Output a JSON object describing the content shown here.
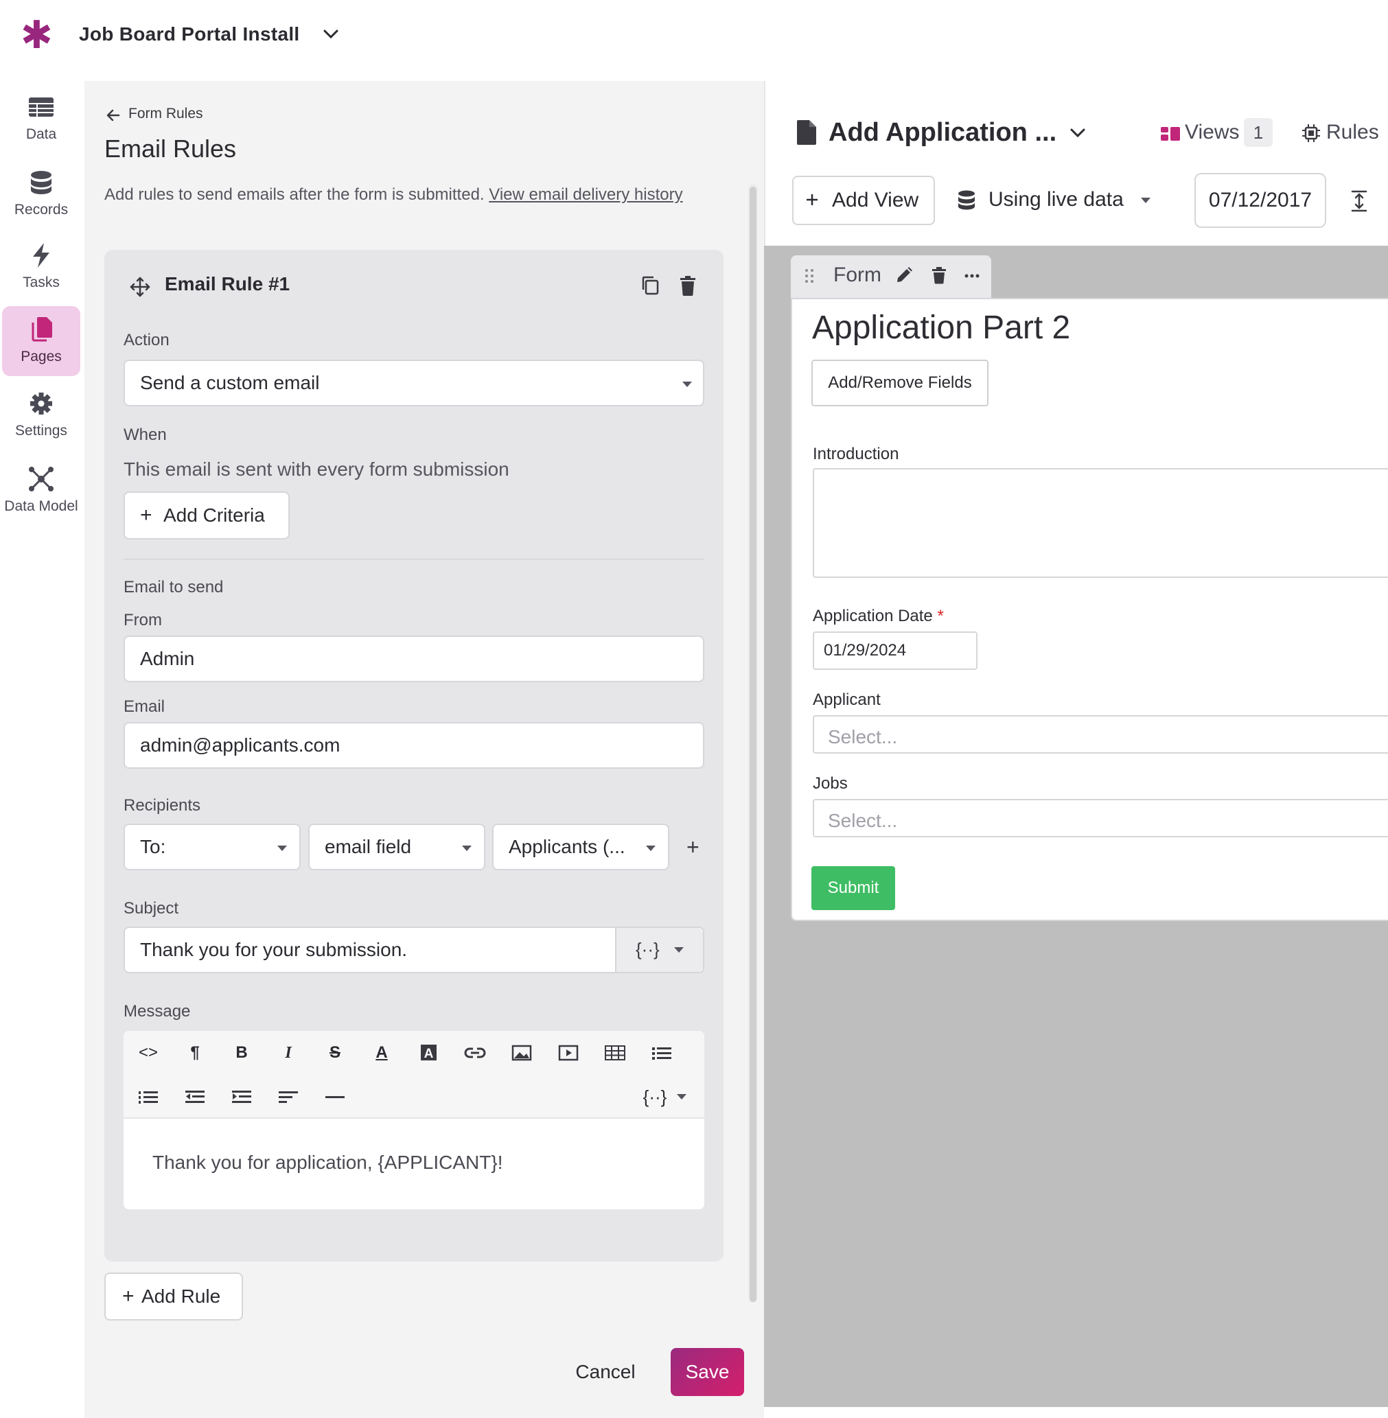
{
  "app": {
    "title": "Job Board Portal Install",
    "brand_color": "#98267d"
  },
  "nav": {
    "items": [
      {
        "label": "Data",
        "icon": "table-icon"
      },
      {
        "label": "Records",
        "icon": "database-icon"
      },
      {
        "label": "Tasks",
        "icon": "lightning-icon"
      },
      {
        "label": "Pages",
        "icon": "pages-icon",
        "active": true
      },
      {
        "label": "Settings",
        "icon": "gear-icon"
      },
      {
        "label": "Data Model",
        "icon": "network-icon"
      }
    ]
  },
  "panel": {
    "back_label": "Form Rules",
    "title": "Email Rules",
    "description": "Add rules to send emails after the form is submitted.",
    "description_link": "View email delivery history",
    "rule": {
      "title": "Email Rule #1",
      "action_label": "Action",
      "action_value": "Send a custom email",
      "when_label": "When",
      "when_text": "This email is sent with every form submission",
      "add_criteria": "Add Criteria",
      "email_to_send_label": "Email to send",
      "from_label": "From",
      "from_value": "Admin",
      "email_label": "Email",
      "email_value": "admin@applicants.com",
      "recipients_label": "Recipients",
      "recipients": [
        "To:",
        "email field",
        "Applicants (..."
      ],
      "subject_label": "Subject",
      "subject_value": "Thank you for your submission.",
      "message_label": "Message",
      "message_value": "Thank you for application, {APPLICANT}!",
      "var_symbol": "{··}"
    },
    "add_rule": "Add Rule",
    "cancel": "Cancel",
    "save": "Save"
  },
  "right": {
    "page_title": "Add Application ...",
    "views_label": "Views",
    "views_count": "1",
    "rules_label": "Rules",
    "add_view": "Add View",
    "live_data": "Using live data",
    "date": "07/12/2017",
    "form_tab_label": "Form",
    "form": {
      "title": "Application Part 2",
      "add_remove_fields": "Add/Remove Fields",
      "intro_label": "Introduction",
      "app_date_label": "Application Date",
      "required_mark": "*",
      "app_date_value": "01/29/2024",
      "applicant_label": "Applicant",
      "applicant_placeholder": "Select...",
      "jobs_label": "Jobs",
      "jobs_placeholder": "Select...",
      "submit": "Submit"
    }
  }
}
